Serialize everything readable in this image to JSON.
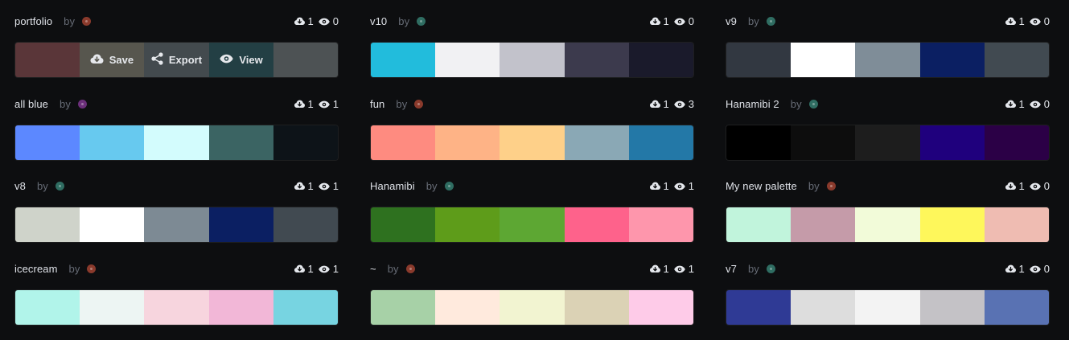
{
  "actions": {
    "save_label": "Save",
    "export_label": "Export",
    "view_label": "View"
  },
  "icons": {
    "download": "cloud-download-icon",
    "views": "eye-icon"
  },
  "palettes": [
    {
      "name": "portfolio",
      "by": "by",
      "avatar": "#8a3a2c",
      "downloads": "1",
      "views": "0",
      "colors": [
        "#5a3639",
        "#57564e",
        "#434a4e",
        "#233f44",
        "#4d5254"
      ],
      "hover": true
    },
    {
      "name": "v10",
      "by": "by",
      "avatar": "#2f6d62",
      "downloads": "1",
      "views": "0",
      "colors": [
        "#22bcdc",
        "#f1f1f3",
        "#c2c2cb",
        "#3c3a4d",
        "#1a1a2b"
      ]
    },
    {
      "name": "v9",
      "by": "by",
      "avatar": "#2f6d62",
      "downloads": "1",
      "views": "0",
      "colors": [
        "#323841",
        "#ffffff",
        "#7f8d98",
        "#0b1f62",
        "#414a51"
      ]
    },
    {
      "name": "all blue",
      "by": "by",
      "avatar": "#6b2f7a",
      "downloads": "1",
      "views": "1",
      "colors": [
        "#5c88ff",
        "#67c9ef",
        "#d3fcfd",
        "#3b6463",
        "#0d1318"
      ]
    },
    {
      "name": "fun",
      "by": "by",
      "avatar": "#8a3a2c",
      "downloads": "1",
      "views": "3",
      "colors": [
        "#fe8b80",
        "#feb386",
        "#fed089",
        "#8aa8b5",
        "#2378a7"
      ]
    },
    {
      "name": "Hanamibi 2",
      "by": "by",
      "avatar": "#2f6d62",
      "downloads": "1",
      "views": "0",
      "colors": [
        "#000000",
        "#0d0d0d",
        "#1d1d1d",
        "#1f007d",
        "#2b0046"
      ]
    },
    {
      "name": "v8",
      "by": "by",
      "avatar": "#2f6d62",
      "downloads": "1",
      "views": "1",
      "colors": [
        "#cfd3ca",
        "#ffffff",
        "#7d8a94",
        "#0b1f62",
        "#414a51"
      ]
    },
    {
      "name": "Hanamibi",
      "by": "by",
      "avatar": "#2f6d62",
      "downloads": "1",
      "views": "1",
      "colors": [
        "#2e711f",
        "#5e9c1a",
        "#5da733",
        "#fe628b",
        "#fe96ac"
      ]
    },
    {
      "name": "My new palette",
      "by": "by",
      "avatar": "#8a3a2c",
      "downloads": "1",
      "views": "0",
      "colors": [
        "#c1f4dc",
        "#c59ba9",
        "#f2fbd9",
        "#fef75b",
        "#efbcb2"
      ]
    },
    {
      "name": "icecream",
      "by": "by",
      "avatar": "#8a3a2c",
      "downloads": "1",
      "views": "1",
      "colors": [
        "#b1f4ea",
        "#edf5f3",
        "#f7d5de",
        "#f2b7d7",
        "#77d4e1"
      ]
    },
    {
      "name": "~",
      "by": "by",
      "avatar": "#8a3a2c",
      "downloads": "1",
      "views": "1",
      "colors": [
        "#a7d1a7",
        "#ffeadd",
        "#f2f4d1",
        "#dbd2b5",
        "#fecbe8"
      ]
    },
    {
      "name": "v7",
      "by": "by",
      "avatar": "#2f6d62",
      "downloads": "1",
      "views": "0",
      "colors": [
        "#2f3a95",
        "#dddddd",
        "#f3f3f3",
        "#c4c2c6",
        "#5972b3"
      ]
    }
  ]
}
